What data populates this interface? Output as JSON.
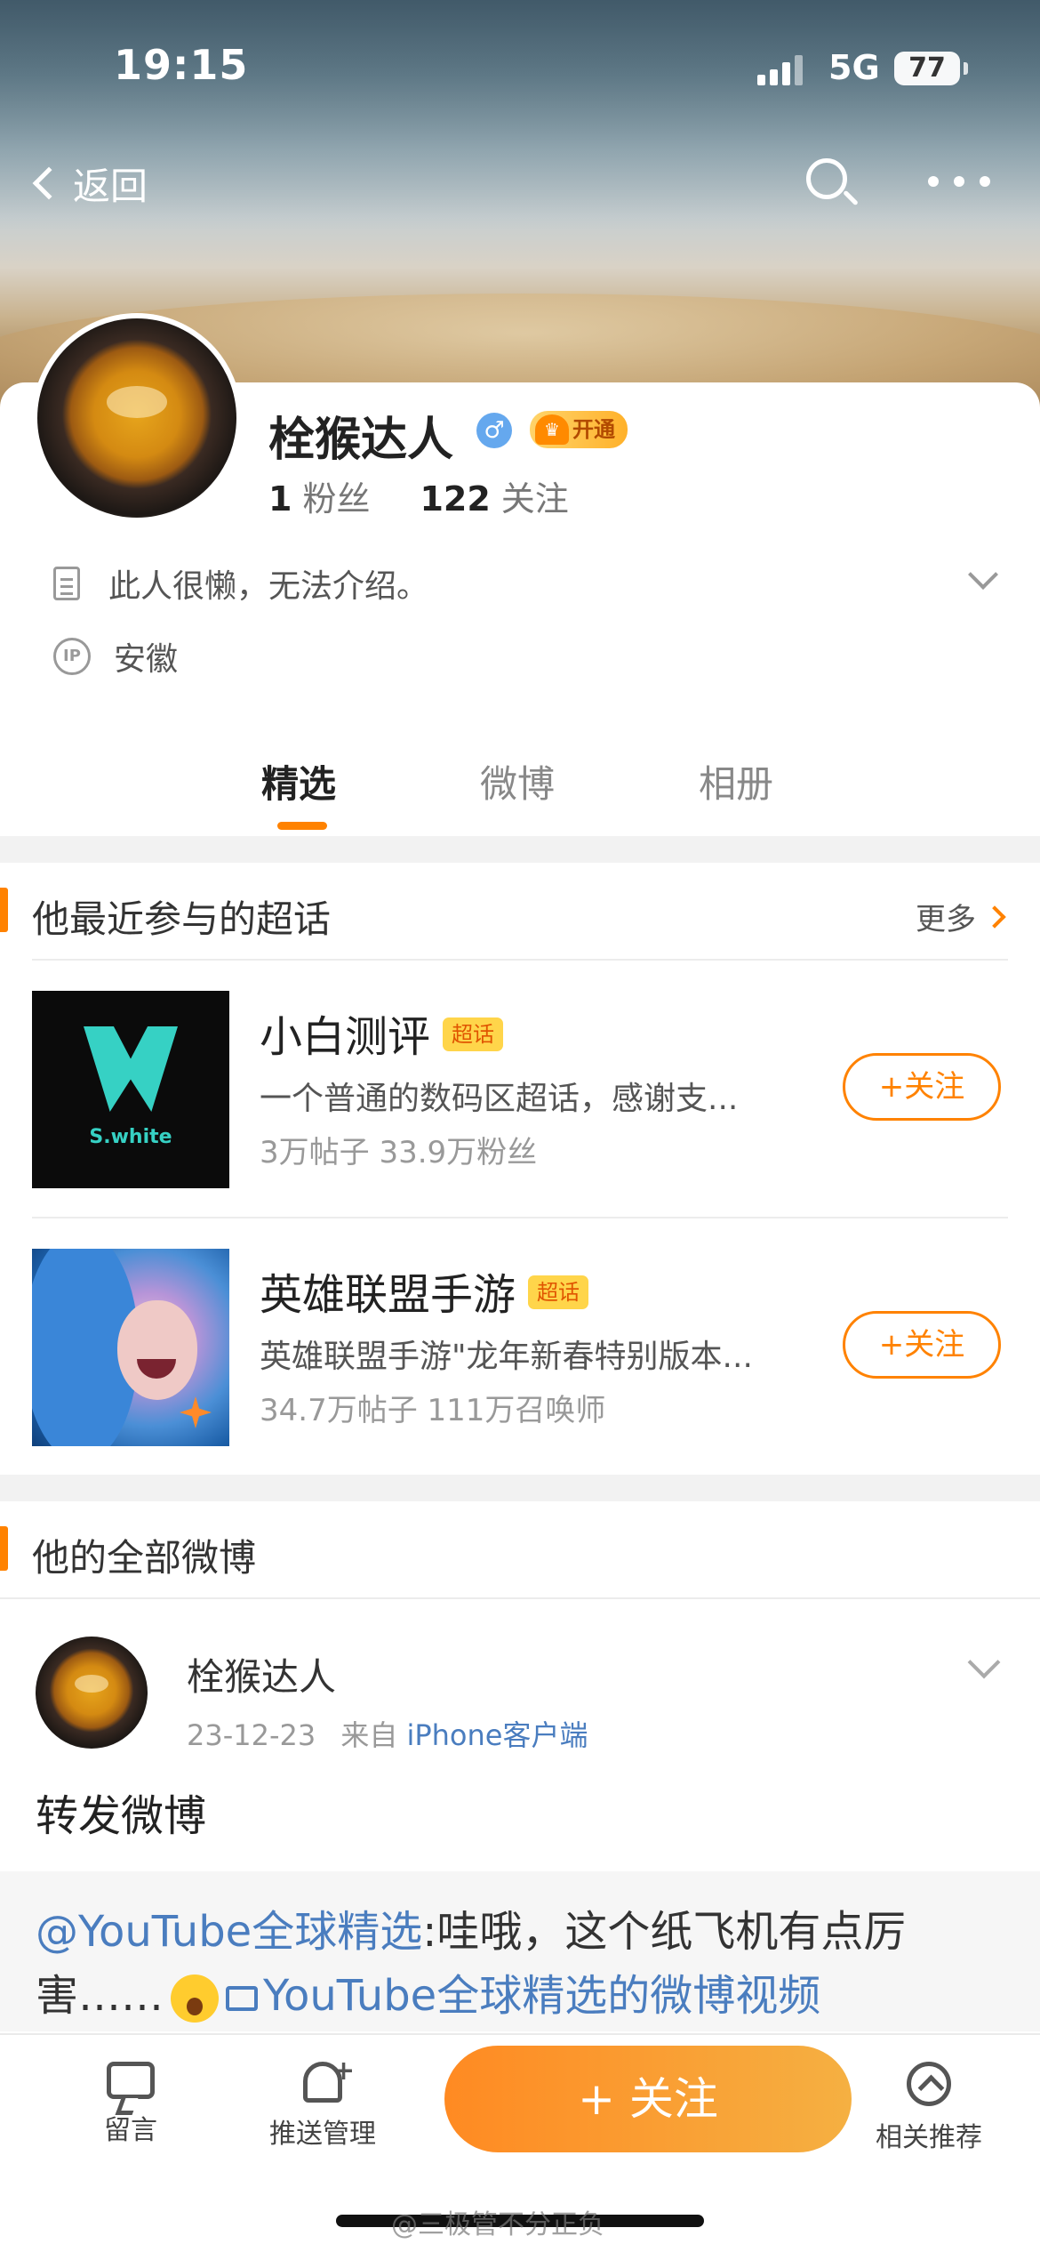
{
  "status_bar": {
    "time": "19:15",
    "network": "5G",
    "battery": "77"
  },
  "nav": {
    "back_label": "返回"
  },
  "profile": {
    "name": "栓猴达人",
    "gender_symbol": "♂",
    "vip_label": "开通",
    "followers_count": "1",
    "followers_label": "粉丝",
    "following_count": "122",
    "following_label": "关注",
    "bio": "此人很懒，无法介绍。",
    "ip_badge": "IP",
    "ip_location": "安徽"
  },
  "tabs": [
    {
      "label": "精选",
      "active": true
    },
    {
      "label": "微博",
      "active": false
    },
    {
      "label": "相册",
      "active": false
    }
  ],
  "super_topics": {
    "title": "他最近参与的超话",
    "more_label": "更多",
    "items": [
      {
        "name": "小白测评",
        "badge": "超话",
        "logo_text": "S.white",
        "desc": "一个普通的数码区超话，感谢支...",
        "stats": "3万帖子 33.9万粉丝",
        "follow_label": "+关注"
      },
      {
        "name": "英雄联盟手游",
        "badge": "超话",
        "desc": "英雄联盟手游\"龙年新春特别版本...",
        "stats": "34.7万帖子 111万召唤师",
        "follow_label": "+关注"
      }
    ]
  },
  "all_weibo": {
    "title": "他的全部微博",
    "post": {
      "author": "栓猴达人",
      "date": "23-12-23",
      "from_label": "来自",
      "source": "iPhone客户端",
      "text": "转发微博",
      "quote_mention": "@YouTube全球精选",
      "quote_text": ":哇哦，这个纸飞机有点厉害……",
      "quote_video_link": "YouTube全球精选的微博视频"
    }
  },
  "bottom_bar": {
    "comment_label": "留言",
    "push_label": "推送管理",
    "follow_label": "+ 关注",
    "related_label": "相关推荐"
  },
  "watermark": "@三极管不分正负",
  "colors": {
    "accent": "#ff8200",
    "link": "#4a7dbf"
  }
}
